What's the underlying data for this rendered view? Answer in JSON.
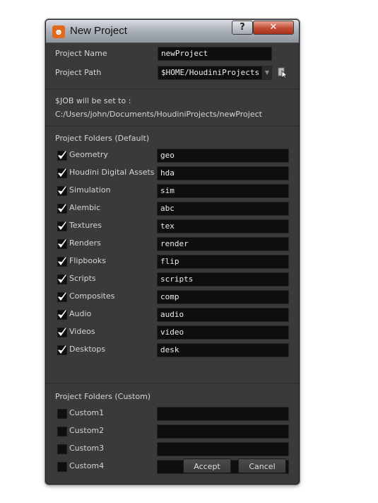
{
  "window": {
    "title": "New Project",
    "help_label": "?",
    "close_label": "✕"
  },
  "project": {
    "name_label": "Project Name",
    "name_value": "newProject",
    "path_label": "Project Path",
    "path_value": "$HOME/HoudiniProjects",
    "job_label": "$JOB will be set to :",
    "job_value": "C:/Users/john/Documents/HoudiniProjects/newProject"
  },
  "default_folders": {
    "heading": "Project Folders (Default)",
    "items": [
      {
        "label": "Geometry",
        "value": "geo",
        "checked": true
      },
      {
        "label": "Houdini Digital Assets",
        "value": "hda",
        "checked": true
      },
      {
        "label": "Simulation",
        "value": "sim",
        "checked": true
      },
      {
        "label": "Alembic",
        "value": "abc",
        "checked": true
      },
      {
        "label": "Textures",
        "value": "tex",
        "checked": true
      },
      {
        "label": "Renders",
        "value": "render",
        "checked": true
      },
      {
        "label": "Flipbooks",
        "value": "flip",
        "checked": true
      },
      {
        "label": "Scripts",
        "value": "scripts",
        "checked": true
      },
      {
        "label": "Composites",
        "value": "comp",
        "checked": true
      },
      {
        "label": "Audio",
        "value": "audio",
        "checked": true
      },
      {
        "label": "Videos",
        "value": "video",
        "checked": true
      },
      {
        "label": "Desktops",
        "value": "desk",
        "checked": true
      }
    ]
  },
  "custom_folders": {
    "heading": "Project Folders (Custom)",
    "items": [
      {
        "label": "Custom1",
        "value": "",
        "checked": false
      },
      {
        "label": "Custom2",
        "value": "",
        "checked": false
      },
      {
        "label": "Custom3",
        "value": "",
        "checked": false
      },
      {
        "label": "Custom4",
        "value": "",
        "checked": false
      }
    ]
  },
  "buttons": {
    "accept": "Accept",
    "cancel": "Cancel"
  },
  "colors": {
    "window_bg": "#3a3a3a",
    "field_bg": "#0e0e0e",
    "text": "#d4d4d4",
    "close_button": "#c44c34",
    "app_icon": "#e06a1b"
  },
  "icons": {
    "app": "houdini-logo-icon",
    "checkbox_check": "checkmark-icon",
    "dropdown": "chevron-down-icon",
    "browse": "file-browse-icon"
  }
}
